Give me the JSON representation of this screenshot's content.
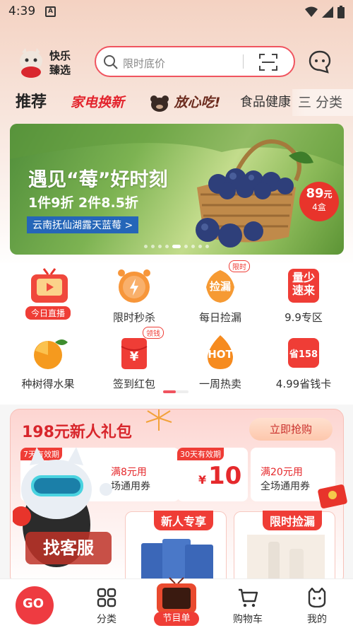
{
  "status_bar": {
    "time": "4:39",
    "app_icon_letter": "A"
  },
  "header": {
    "logo_line1": "快乐",
    "logo_line2": "臻选",
    "search_placeholder": "限时底价"
  },
  "tabs": [
    {
      "label": "推荐"
    },
    {
      "label": "家电换新"
    },
    {
      "label": "放心吃!"
    },
    {
      "label": "食品健康"
    },
    {
      "label": "三 分类"
    }
  ],
  "banner": {
    "headline": "遇见“莓”好时刻",
    "subline": "1件9折 2件8.5折",
    "location_tag": "云南抚仙湖露天蓝莓 >",
    "price": "89",
    "price_unit": "元",
    "quantity": "4盒",
    "slide_count": 9,
    "active_slide": 5
  },
  "shortcuts": [
    {
      "label": "今日直播",
      "icon": "live-tv-icon"
    },
    {
      "label": "限时秒杀",
      "icon": "alarm-clock-icon"
    },
    {
      "label": "每日捡漏",
      "icon": "pick-deal-icon",
      "badge": "限时",
      "icon_text": "捡漏"
    },
    {
      "label": "9.9专区",
      "icon": "small-quick-icon",
      "icon_text": "量少速来"
    },
    {
      "label": "种树得水果",
      "icon": "orange-icon"
    },
    {
      "label": "签到红包",
      "icon": "red-envelope-icon",
      "badge": "领钱",
      "icon_text": "¥"
    },
    {
      "label": "一周热卖",
      "icon": "hot-flame-icon",
      "icon_text": "HOT"
    },
    {
      "label": "4.99省钱卡",
      "icon": "save-card-icon",
      "icon_text": "省158"
    }
  ],
  "gift_pack": {
    "title": "198元新人礼包",
    "cta": "立即抢购",
    "coupons": [
      {
        "tag": "7天有效期",
        "line1": "满8元用",
        "line2": "场通用券"
      },
      {
        "tag": "30天有效期",
        "currency": "¥",
        "amount": "10"
      },
      {
        "line1": "满20元用",
        "line2": "全场通用券"
      }
    ],
    "sub_cards": [
      {
        "title": "新人专享"
      },
      {
        "title": "限时捡漏"
      }
    ]
  },
  "floating_service": {
    "label": "找客服"
  },
  "bottom_nav": {
    "home_label": "GO",
    "items": [
      {
        "label": "分类",
        "icon": "grid-icon"
      },
      {
        "label": "节目单",
        "icon": "festival-tv-icon"
      },
      {
        "label": "购物车",
        "icon": "cart-icon"
      },
      {
        "label": "我的",
        "icon": "cat-face-icon"
      }
    ]
  },
  "colors": {
    "accent": "#ef3d36",
    "search_border": "#f0545f",
    "brand_red": "#e3232c"
  }
}
